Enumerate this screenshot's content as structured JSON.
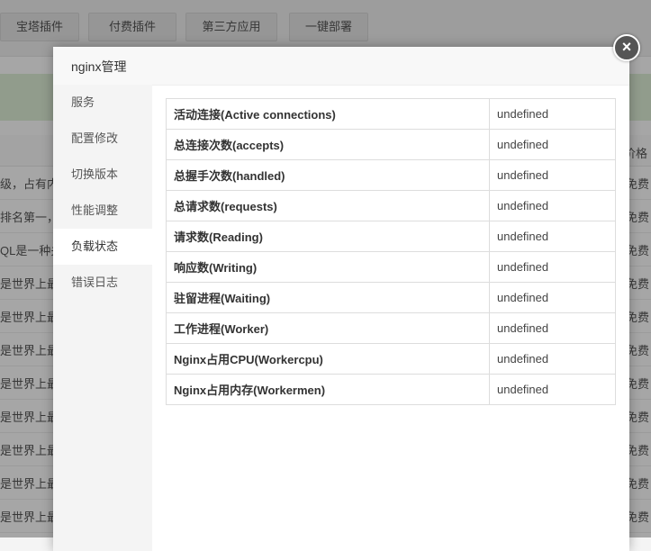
{
  "background": {
    "tabs": [
      "宝塔插件",
      "付费插件",
      "第三方应用",
      "一键部署"
    ],
    "price_header": "价格",
    "rows": [
      {
        "text": "级，占有内存",
        "price": "免费"
      },
      {
        "text": "排名第一，(",
        "price": "免费"
      },
      {
        "text": "QL是一种关",
        "price": "免费"
      },
      {
        "text": "是世界上最好",
        "price": "免费"
      },
      {
        "text": "是世界上最好",
        "price": "免费"
      },
      {
        "text": "是世界上最好",
        "price": "免费"
      },
      {
        "text": "是世界上最好",
        "price": "免费"
      },
      {
        "text": "是世界上最好",
        "price": "免费"
      },
      {
        "text": "是世界上最好",
        "price": "免费"
      },
      {
        "text": "是世界上最好",
        "price": "免费"
      },
      {
        "text": "是世界上最好",
        "price": "免费"
      }
    ]
  },
  "modal": {
    "title": "nginx管理",
    "close_icon": "×",
    "sidebar": [
      "服务",
      "配置修改",
      "切换版本",
      "性能调整",
      "负载状态",
      "错误日志"
    ],
    "active_index": 4,
    "status_rows": [
      {
        "label": "活动连接(Active connections)",
        "value": "undefined"
      },
      {
        "label": "总连接次数(accepts)",
        "value": "undefined"
      },
      {
        "label": "总握手次数(handled)",
        "value": "undefined"
      },
      {
        "label": "总请求数(requests)",
        "value": "undefined"
      },
      {
        "label": "请求数(Reading)",
        "value": "undefined"
      },
      {
        "label": "响应数(Writing)",
        "value": "undefined"
      },
      {
        "label": "驻留进程(Waiting)",
        "value": "undefined"
      },
      {
        "label": "工作进程(Worker)",
        "value": "undefined"
      },
      {
        "label": "Nginx占用CPU(Workercpu)",
        "value": "undefined"
      },
      {
        "label": "Nginx占用内存(Workermen)",
        "value": "undefined"
      }
    ]
  }
}
